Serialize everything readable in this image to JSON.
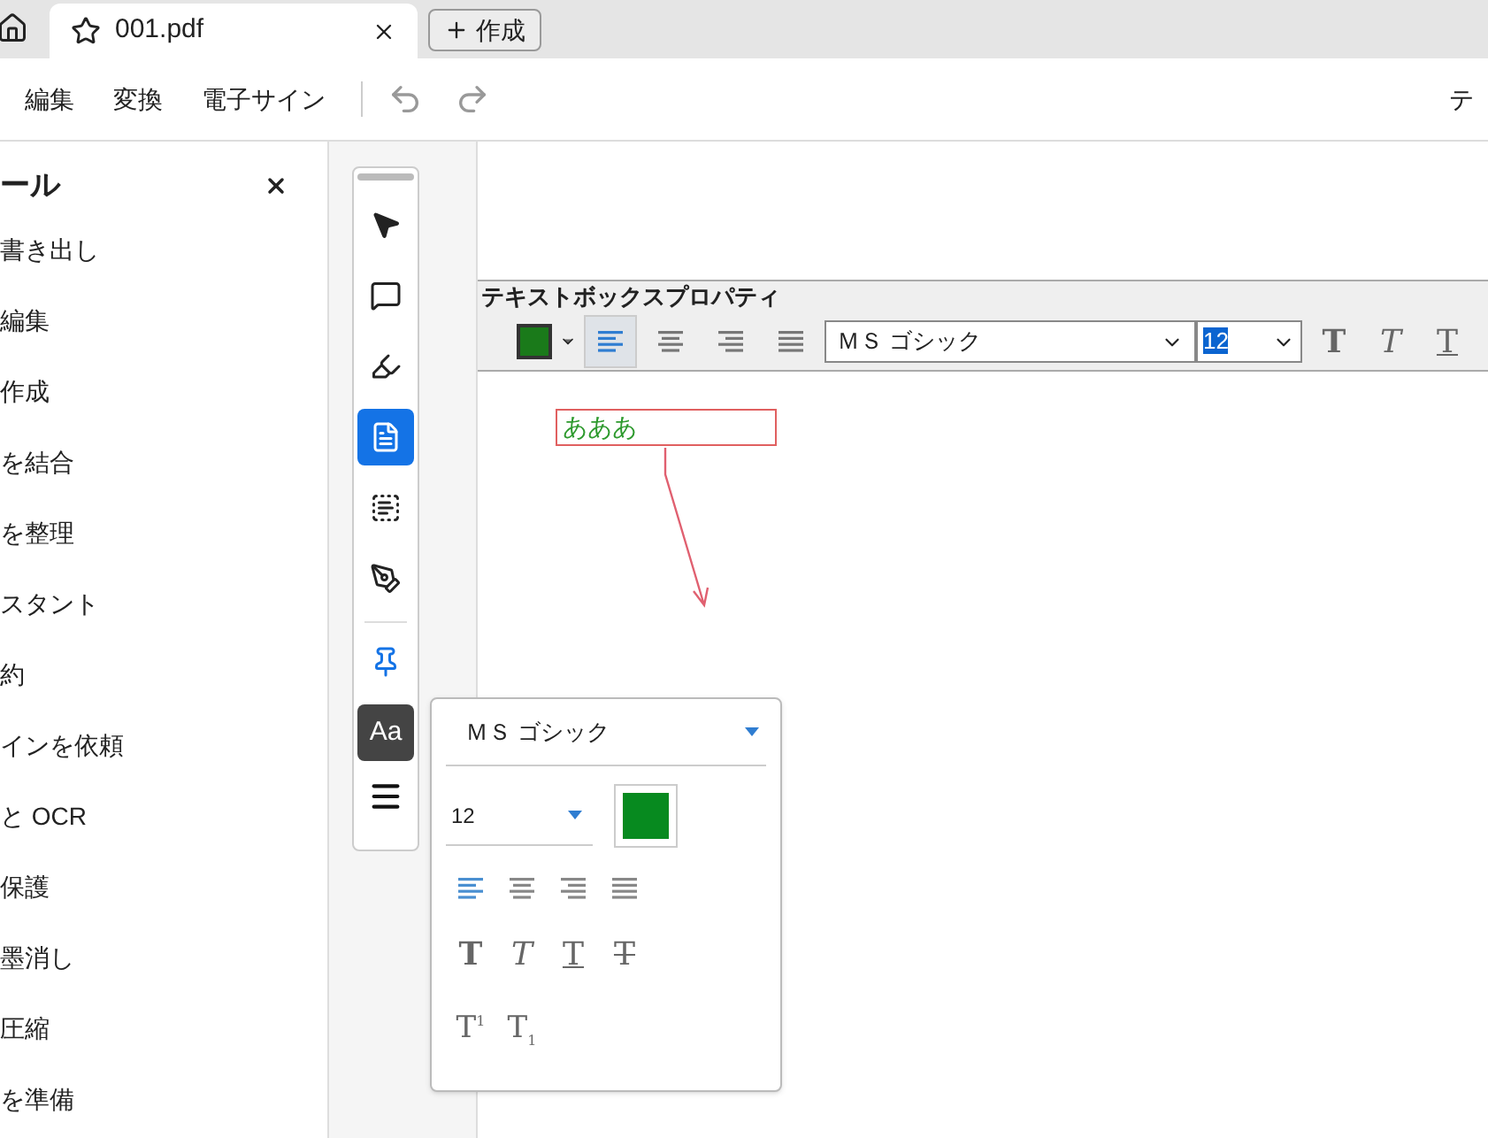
{
  "tabs": [
    {
      "label": "001.pdf",
      "selected": true
    }
  ],
  "new_button": {
    "label": "作成"
  },
  "menu": [
    "編集",
    "変換",
    "電子サイン"
  ],
  "menu_right": "テ",
  "tools_panel": {
    "title": "ール",
    "items": [
      "書き出し",
      "編集",
      "作成",
      "を結合",
      "を整理",
      "スタント",
      "約",
      "インを依頼",
      "と OCR",
      "保護",
      "墨消し",
      "圧縮",
      "を準備"
    ]
  },
  "toolbar": [
    {
      "kind": "select",
      "selected": false
    },
    {
      "kind": "comment",
      "selected": false
    },
    {
      "kind": "highlight",
      "selected": false
    },
    {
      "kind": "textbox",
      "selected": true
    },
    {
      "kind": "textfield",
      "selected": false
    },
    {
      "kind": "sign",
      "selected": false
    },
    {
      "kind": "pin",
      "selected": false
    },
    {
      "kind": "font",
      "label": "Aa",
      "selected": true
    },
    {
      "kind": "menu",
      "selected": false
    }
  ],
  "properties_bar": {
    "title": "テキストボックスプロパティ",
    "color": "#1a7a1a",
    "alignments": [
      {
        "kind": "left",
        "selected": true
      },
      {
        "kind": "center",
        "selected": false
      },
      {
        "kind": "right",
        "selected": false
      },
      {
        "kind": "justify",
        "selected": false
      }
    ],
    "font": "ＭＳ ゴシック",
    "size": "12",
    "styles": [
      {
        "kind": "bold",
        "glyph": "T"
      },
      {
        "kind": "italic",
        "glyph": "T"
      },
      {
        "kind": "underline",
        "glyph": "T"
      }
    ]
  },
  "textbox": {
    "text": "あああ"
  },
  "popup": {
    "font": "ＭＳ ゴシック",
    "size": "12",
    "color": "#078a1f",
    "alignments": [
      {
        "kind": "left",
        "selected": true
      },
      {
        "kind": "center",
        "selected": false
      },
      {
        "kind": "right",
        "selected": false
      },
      {
        "kind": "justify",
        "selected": false
      }
    ],
    "styles": [
      {
        "kind": "bold",
        "glyph": "T"
      },
      {
        "kind": "italic",
        "glyph": "T"
      },
      {
        "kind": "underline",
        "glyph": "T"
      },
      {
        "kind": "strike",
        "glyph": "T"
      }
    ],
    "scripts": [
      {
        "kind": "super",
        "glyph": "T",
        "mark": "1"
      },
      {
        "kind": "sub",
        "glyph": "T",
        "mark": "1"
      }
    ]
  }
}
